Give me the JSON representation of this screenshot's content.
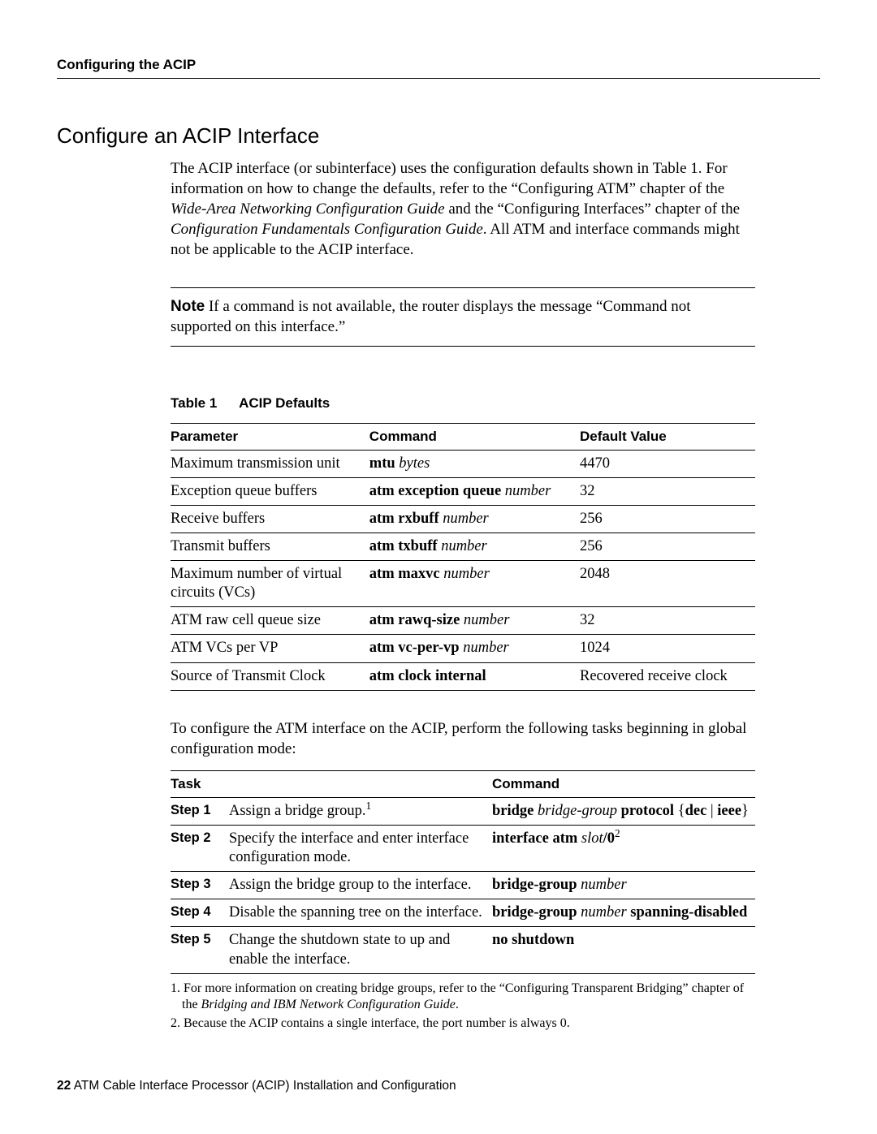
{
  "running_head": "Configuring the ACIP",
  "section_title": "Configure an ACIP Interface",
  "intro": {
    "s1": "The ACIP interface (or subinterface) uses the configuration defaults shown in Table 1. For information on how to change the defaults, refer to the “Configuring ATM” chapter of the ",
    "i1": "Wide-Area Networking Configuration Guide",
    "s2": " and the “Configuring Interfaces” chapter of the ",
    "i2": "Configuration Fundamentals Configuration Guide",
    "s3": ". All ATM and interface commands might not be applicable to the ACIP interface."
  },
  "note": {
    "label": "Note",
    "text": "   If a command is not available, the router displays the message “Command not supported on this interface.”"
  },
  "table1": {
    "caption_num": "Table 1",
    "caption_title": "ACIP Defaults",
    "headers": {
      "p": "Parameter",
      "c": "Command",
      "d": "Default Value"
    },
    "rows": [
      {
        "param": "Maximum transmission unit",
        "cmd_b": "mtu ",
        "cmd_i": "bytes",
        "def": "4470"
      },
      {
        "param": "Exception queue buffers",
        "cmd_b": "atm exception queue ",
        "cmd_i": "number",
        "def": "32"
      },
      {
        "param": "Receive buffers",
        "cmd_b": "atm rxbuff ",
        "cmd_i": "number",
        "def": "256"
      },
      {
        "param": "Transmit buffers",
        "cmd_b": "atm txbuff ",
        "cmd_i": "number",
        "def": "256"
      },
      {
        "param": "Maximum number of virtual circuits (VCs)",
        "cmd_b": "atm maxvc ",
        "cmd_i": "number",
        "def": "2048"
      },
      {
        "param": "ATM raw cell queue size",
        "cmd_b": "atm rawq-size ",
        "cmd_i": "number",
        "def": "32"
      },
      {
        "param": "ATM VCs per VP",
        "cmd_b": "atm vc-per-vp ",
        "cmd_i": "number",
        "def": "1024"
      },
      {
        "param": "Source of Transmit Clock",
        "cmd_b": "atm clock internal",
        "cmd_i": "",
        "def": "Recovered receive clock"
      }
    ]
  },
  "after_table_para": "To configure the ATM interface on the ACIP, perform the following tasks beginning in global configuration mode:",
  "tasks": {
    "headers": {
      "t": "Task",
      "c": "Command"
    },
    "rows": [
      {
        "step": "Step 1",
        "task_pre": "Assign a bridge group.",
        "task_sup": "1",
        "cmd_parts": [
          {
            "t": "bridge ",
            "cls": "b"
          },
          {
            "t": "bridge-group",
            "cls": "i"
          },
          {
            "t": " protocol ",
            "cls": "b"
          },
          {
            "t": "{",
            "cls": ""
          },
          {
            "t": "dec",
            "cls": "b"
          },
          {
            "t": " | ",
            "cls": ""
          },
          {
            "t": "ieee",
            "cls": "b"
          },
          {
            "t": "}",
            "cls": ""
          }
        ]
      },
      {
        "step": "Step 2",
        "task_pre": "Specify the interface and enter interface configuration mode.",
        "task_sup": "",
        "cmd_parts": [
          {
            "t": "interface atm ",
            "cls": "b"
          },
          {
            "t": "slot",
            "cls": "i"
          },
          {
            "t": "/0",
            "cls": "b"
          }
        ],
        "cmd_sup": "2"
      },
      {
        "step": "Step 3",
        "task_pre": "Assign the bridge group to the interface.",
        "task_sup": "",
        "cmd_parts": [
          {
            "t": "bridge-group ",
            "cls": "b"
          },
          {
            "t": "number",
            "cls": "i"
          }
        ]
      },
      {
        "step": "Step 4",
        "task_pre": "Disable the spanning tree on the interface.",
        "task_sup": "",
        "cmd_parts": [
          {
            "t": "bridge-group ",
            "cls": "b"
          },
          {
            "t": "number",
            "cls": "i"
          },
          {
            "t": " spanning-disabled",
            "cls": "b"
          }
        ]
      },
      {
        "step": "Step 5",
        "task_pre": "Change the shutdown state to up and enable the interface.",
        "task_sup": "",
        "cmd_parts": [
          {
            "t": "no shutdown",
            "cls": "b"
          }
        ]
      }
    ]
  },
  "footnotes": {
    "f1_pre": "1. For more information on creating bridge groups, refer to the “Configuring Transparent Bridging” chapter of the ",
    "f1_i": "Bridging and IBM Network Configuration Guide",
    "f1_post": ".",
    "f2": "2. Because the ACIP contains a single interface, the port number is always 0."
  },
  "footer": {
    "page": "22",
    "title": "  ATM Cable Interface Processor (ACIP) Installation and Configuration"
  }
}
